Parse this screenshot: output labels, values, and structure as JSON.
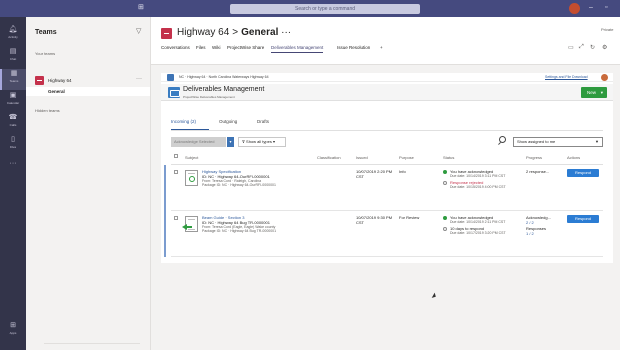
{
  "titlebar": {
    "search_placeholder": "Search or type a command"
  },
  "rail": {
    "items": [
      {
        "label": "Activity",
        "icon": "bell-icon"
      },
      {
        "label": "Chat",
        "icon": "chat-icon"
      },
      {
        "label": "Teams",
        "icon": "teams-icon"
      },
      {
        "label": "Calendar",
        "icon": "calendar-icon"
      },
      {
        "label": "Calls",
        "icon": "phone-icon"
      },
      {
        "label": "Files",
        "icon": "file-icon"
      }
    ],
    "more": "···",
    "apps_label": "Apps"
  },
  "teams_pane": {
    "title": "Teams",
    "section_your_teams": "Your teams",
    "team_name": "Highway 64",
    "team_more": "···",
    "channel_name": "General",
    "section_hidden": "Hidden teams"
  },
  "header": {
    "team": "Highway 64",
    "separator": ">",
    "channel": "General",
    "channel_more": "···",
    "private_label": "Private",
    "tabs": [
      "Conversations",
      "Files",
      "Wiki",
      "ProjectWise Share",
      "Deliverables Management",
      "Issue Resolution",
      "+"
    ]
  },
  "projectwise": {
    "breadcrumb": "NC · Highway 64 · North Carolina Waterways Highway 64",
    "link": "Settings and File Download",
    "banner_title": "Deliverables Management",
    "banner_subtitle": "ProjectWise Deliverables Management",
    "new_button": "New",
    "sub_tabs": [
      "Incoming (2)",
      "Outgoing",
      "Drafts"
    ],
    "ack_button": "Acknowledge Selected",
    "filter_button": "Show all types",
    "show_select": "Show assigned to me",
    "columns": [
      "Subject",
      "Classification",
      "Issued",
      "Purpose",
      "Status",
      "Progress",
      "Actions"
    ],
    "rows": [
      {
        "title": "Highway Specification",
        "id": "ID: NC · Highway 64-OurRFI-0000001",
        "from": "From: Teresa Cord · Raleigh, Carolina",
        "pkg": "Package ID: NC · Highway 64-OurRFI-0000001",
        "classification": "",
        "issued": "10/07/2019 2:20 PM CST",
        "purpose": "Info",
        "status1": "You have acknowledged",
        "status1_due": "Due date: 10/14/2019 3:11 PM CST",
        "status2": "Response rejected",
        "status2_due": "Due date: 10/15/2019 4:00 PM CST",
        "progress": "2 response...",
        "action": "Respond"
      },
      {
        "title": "Beam Guide · Section 3",
        "id": "ID: NC · Highway 64 Bug TR-0000001",
        "from": "From: Teresa Cord (Eagle, Eagle) Wake county",
        "pkg": "Package ID: NC · Highway 64 Bug TR-0000001",
        "classification": "",
        "issued": "10/07/2019 9:30 PM CST",
        "purpose": "For Review",
        "status1": "You have acknowledged",
        "status1_due": "Due date: 10/14/2019 2:11 PM CST",
        "status2": "10 days to respond",
        "status2_due": "Due date: 10/17/2019 3:20 PM CST",
        "progress": "Acknowledg...",
        "progress_count1": "2 / 2",
        "progress_label2": "Responses",
        "progress_count2": "1 / 2",
        "action": "Respond"
      }
    ]
  },
  "colors": {
    "titlebar": "#454a7f",
    "rail": "#33344a",
    "team_red": "#c4314b",
    "accent_blue": "#2b7cd3",
    "new_green": "#2e9b3f"
  }
}
